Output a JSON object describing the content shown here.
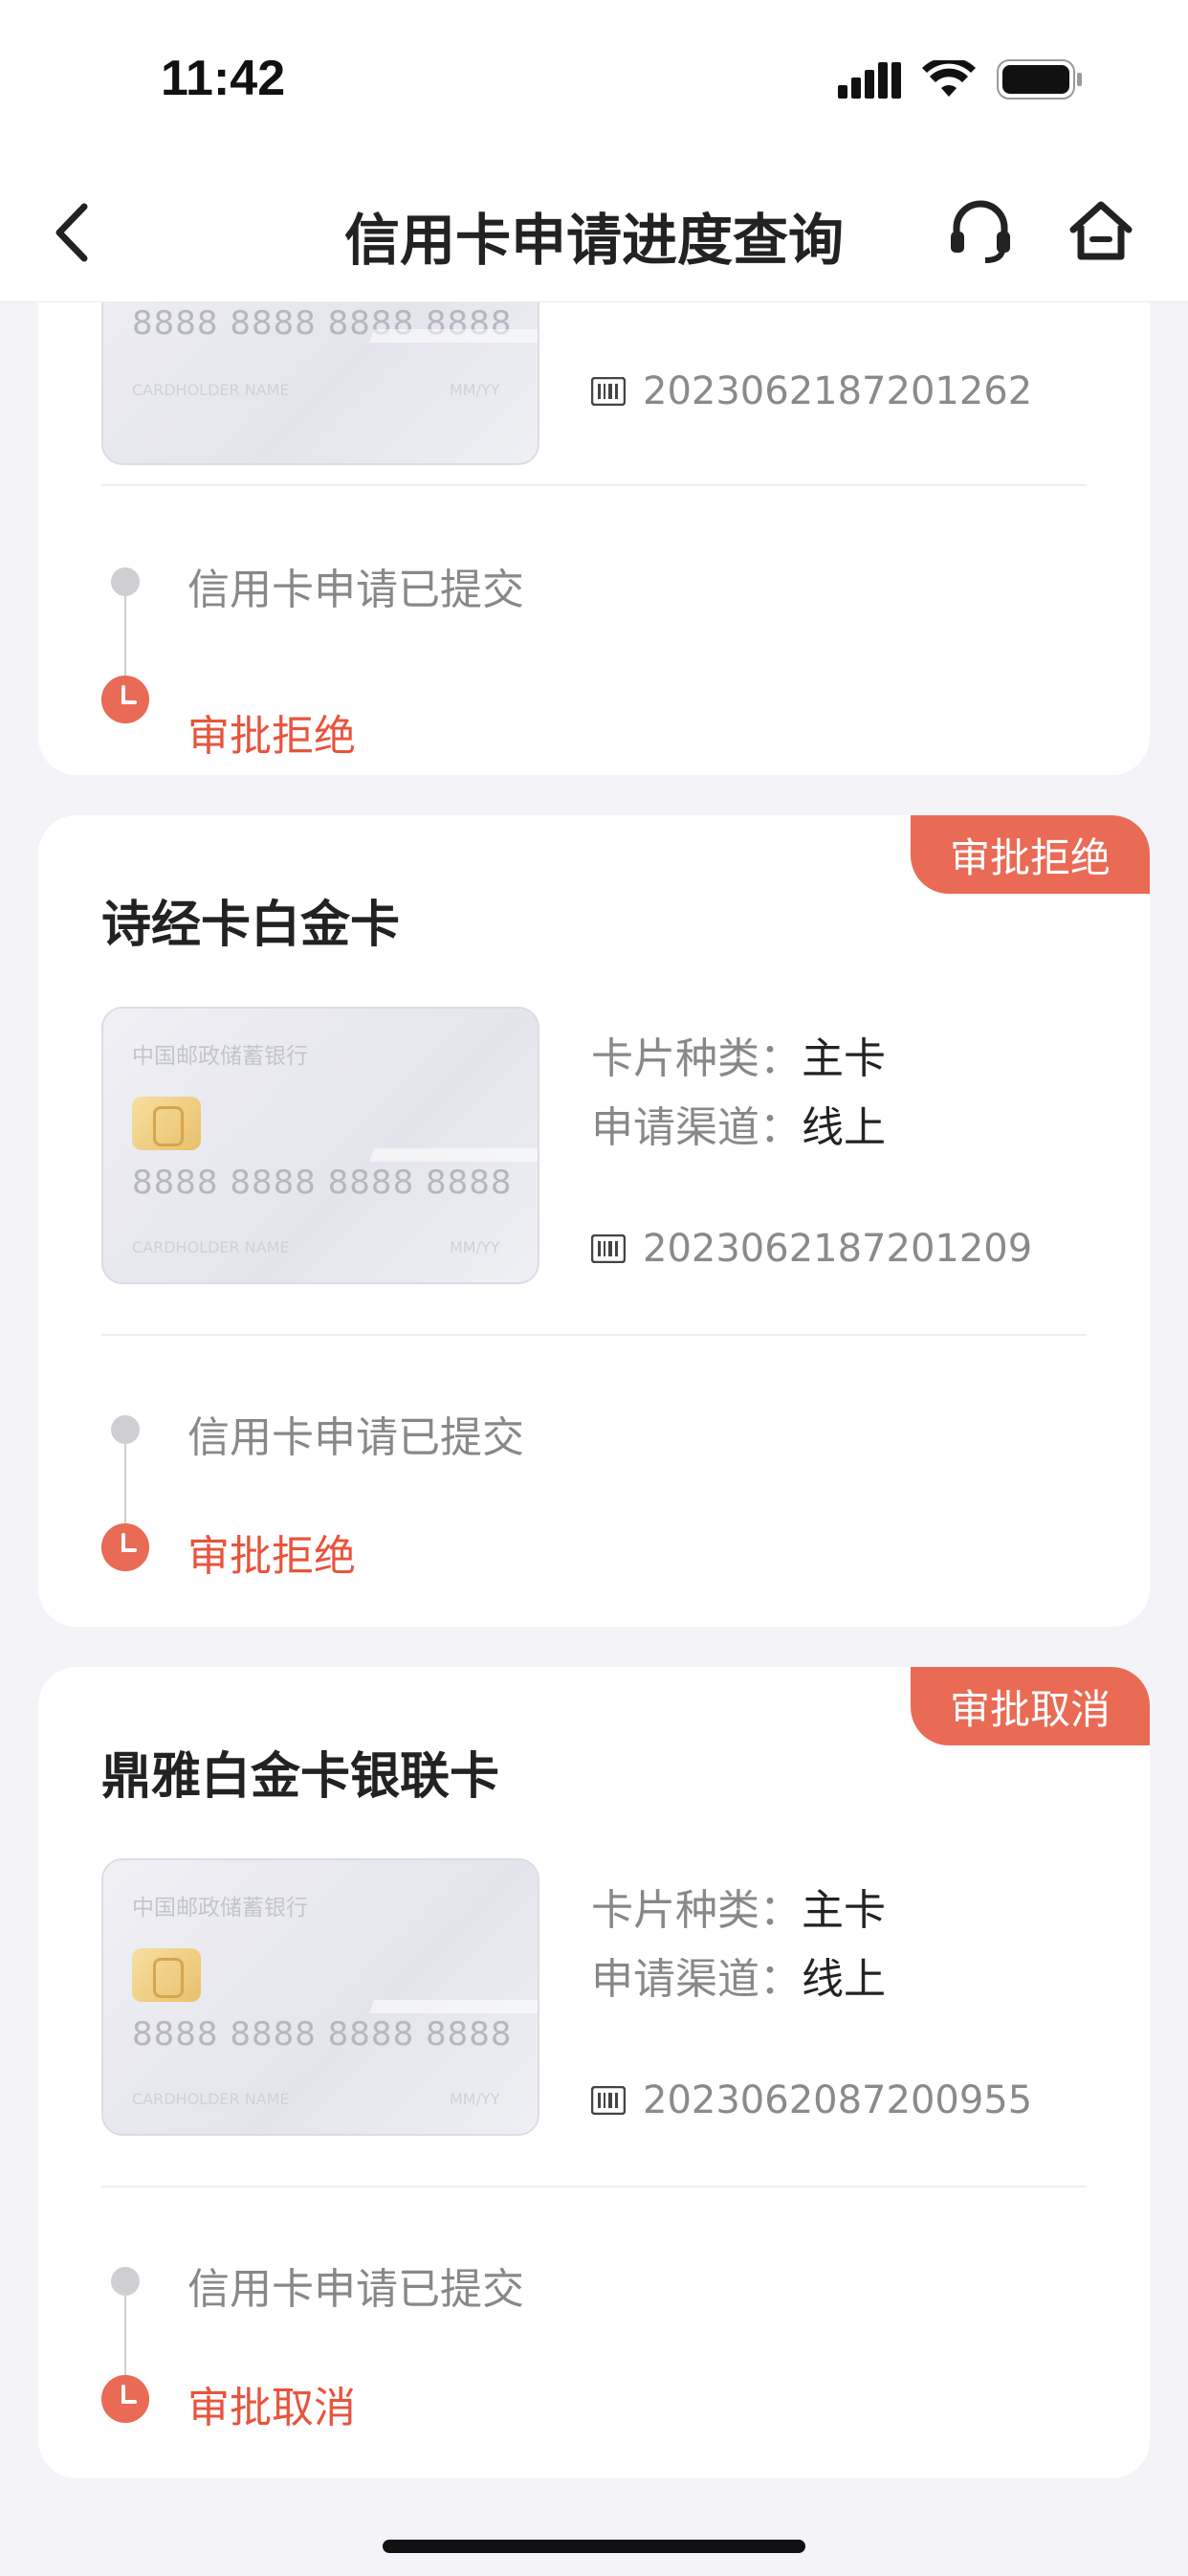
{
  "status_bar": {
    "time": "11:42"
  },
  "nav": {
    "title": "信用卡申请进度查询",
    "back_icon": "back-chevron-icon",
    "support_icon": "headset-icon",
    "home_icon": "home-icon"
  },
  "cards": [
    {
      "card_number": "8888 8888 8888 8888",
      "holder_label": "CARDHOLDER NAME",
      "expiry_label": "MM/YY",
      "application_no": "2023062187201262",
      "timeline": {
        "step1": "信用卡申请已提交",
        "step2": "审批拒绝"
      }
    },
    {
      "badge": "审批拒绝",
      "title": "诗经卡白金卡",
      "bank_name": "中国邮政储蓄银行",
      "card_number": "8888 8888 8888 8888",
      "holder_label": "CARDHOLDER NAME",
      "expiry_label": "MM/YY",
      "type_label": "卡片种类：",
      "type_value": "主卡",
      "channel_label": "申请渠道：",
      "channel_value": "线上",
      "application_no": "2023062187201209",
      "timeline": {
        "step1": "信用卡申请已提交",
        "step2": "审批拒绝"
      }
    },
    {
      "badge": "审批取消",
      "title": "鼎雅白金卡银联卡",
      "bank_name": "中国邮政储蓄银行",
      "card_number": "8888 8888 8888 8888",
      "holder_label": "CARDHOLDER NAME",
      "expiry_label": "MM/YY",
      "type_label": "卡片种类：",
      "type_value": "主卡",
      "channel_label": "申请渠道：",
      "channel_value": "线上",
      "application_no": "2023062087200955",
      "timeline": {
        "step1": "信用卡申请已提交",
        "step2": "审批取消"
      }
    }
  ],
  "colors": {
    "accent": "#e96b55",
    "status_red": "#e8543c",
    "background": "#f4f4f8"
  }
}
